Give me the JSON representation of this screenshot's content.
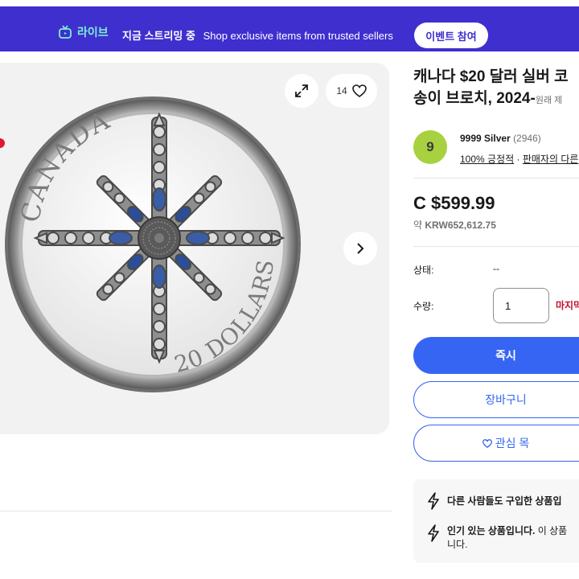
{
  "banner": {
    "live_label": "라이브",
    "live_icon": "live-stream-icon",
    "prefix": "지금 스트리밍 중",
    "text": "Shop exclusive items from trusted sellers",
    "event_button": "이벤트 참여",
    "bg_color": "#3f2fcf"
  },
  "gallery": {
    "watch_count": "14",
    "coin": {
      "top_text": "CANADA",
      "bottom_text": "20 DOLLARS"
    }
  },
  "listing": {
    "title_line1": "캐나다 $20 달러 실버 코",
    "title_line2": "송이 브로치, 2024-",
    "title_orig": "원래 제"
  },
  "seller": {
    "avatar_letter": "9",
    "name": "9999 Silver",
    "count": "(2946)",
    "feedback": "100% 긍정적",
    "other_link": "판매자의 다른"
  },
  "price": {
    "main": "C $599.99",
    "approx_prefix": "약",
    "approx_value": "KRW652,612.75"
  },
  "details": {
    "condition_label": "상태:",
    "condition_value": "--",
    "quantity_label": "수량:",
    "quantity_value": "1",
    "last_item": "마지막"
  },
  "actions": {
    "buy_now": "즉시 ",
    "add_to_cart": "장바구니",
    "watchlist": "관심 목"
  },
  "info": {
    "row1_text": "다른 사람들도 구입한 상품입",
    "row2_bold": "인기 있는 상품입니다.",
    "row2_rest": " 이 상품",
    "row2_line2": "니다."
  },
  "colors": {
    "accent": "#3665f3",
    "seller_avatar": "#a7d13f",
    "urgent": "#c00f2b"
  }
}
